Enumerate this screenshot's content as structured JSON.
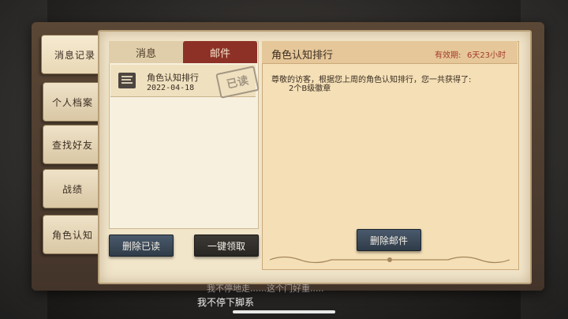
{
  "side_tabs": [
    {
      "label": "消息记录"
    },
    {
      "label": "个人档案"
    },
    {
      "label": "查找好友"
    },
    {
      "label": "战绩"
    },
    {
      "label": "角色认知"
    }
  ],
  "tabs": {
    "messages": "消息",
    "mail": "邮件"
  },
  "mail_list": [
    {
      "title": "角色认知排行",
      "date": "2022-04-18",
      "stamp": "已读"
    }
  ],
  "mail_detail": {
    "subject": "角色认知排行",
    "validity_label": "有效期:",
    "validity_value": "6天23小时",
    "body": "尊敬的访客，根据您上周的角色认知排行，您一共获得了:",
    "reward": "2个B级徽章"
  },
  "buttons": {
    "delete_read": "删除已读",
    "collect_all": "一键领取",
    "delete_mail": "删除邮件"
  },
  "subtitles": {
    "line1": "我不停地走......这个门好重.....",
    "line2": "我不停下脚系"
  },
  "colors": {
    "accent_red": "#8d3126",
    "paper": "#f1e5ca",
    "button_blue": "#3c4a5a"
  }
}
